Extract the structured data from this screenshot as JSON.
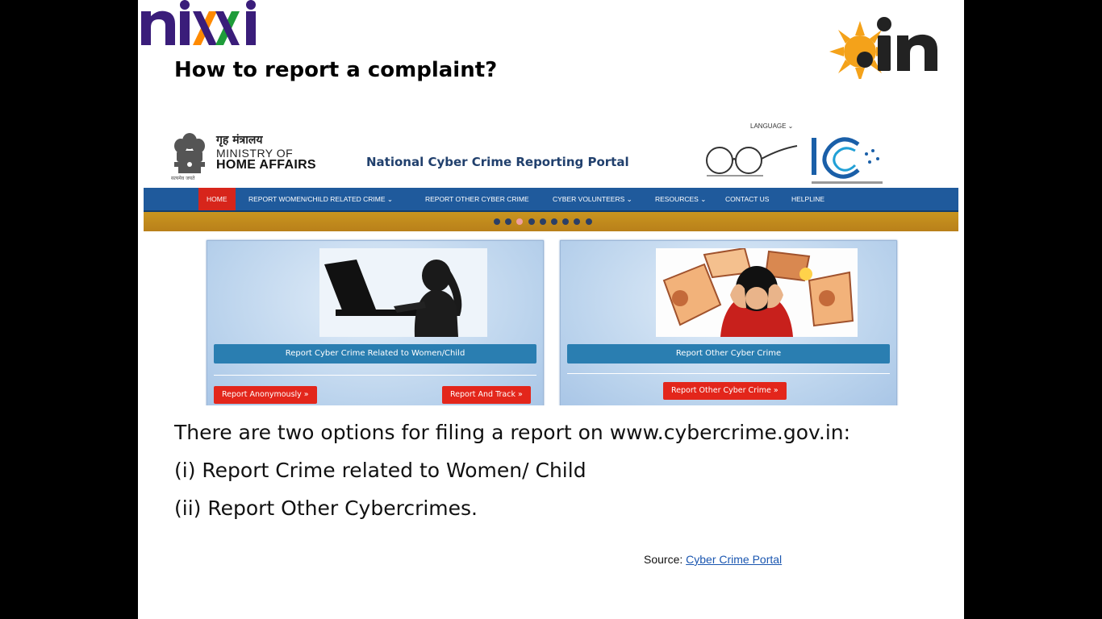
{
  "slide": {
    "title": "How to report a complaint?",
    "logos": {
      "left": "nixi",
      "right": ".in"
    },
    "body_lines": [
      "There are two options for filing a report on www.cybercrime.gov.in:",
      "(i) Report Crime related to Women/ Child",
      "(ii) Report Other Cybercrimes."
    ],
    "source_label": "Source:",
    "source_link": "Cyber Crime Portal"
  },
  "portal": {
    "ministry_hindi": "गृह मंत्रालय",
    "ministry_line1": "MINISTRY OF",
    "ministry_line2": "HOME AFFAIRS",
    "emblem_caption": "सत्यमेव जयते",
    "portal_name": "National Cyber Crime Reporting Portal",
    "language": "LANGUAGE ⌄",
    "nav": [
      "HOME",
      "REPORT WOMEN/CHILD RELATED CRIME ⌄",
      "REPORT OTHER CYBER CRIME",
      "CYBER VOLUNTEERS ⌄",
      "RESOURCES ⌄",
      "CONTACT US",
      "HELPLINE"
    ],
    "carousel_dots": 9,
    "carousel_active_index": 2,
    "cards": [
      {
        "bar_label": "Report Cyber Crime Related to Women/Child",
        "buttons": [
          "Report Anonymously »",
          "Report And Track »"
        ]
      },
      {
        "bar_label": "Report Other Cyber Crime",
        "buttons": [
          "Report Other Cyber Crime »"
        ]
      }
    ]
  },
  "colors": {
    "nav_bg": "#1f5a9c",
    "nav_active": "#d7251b",
    "button_red": "#e3261b",
    "card_bar": "#2a7eb1",
    "portal_title": "#21406d"
  }
}
